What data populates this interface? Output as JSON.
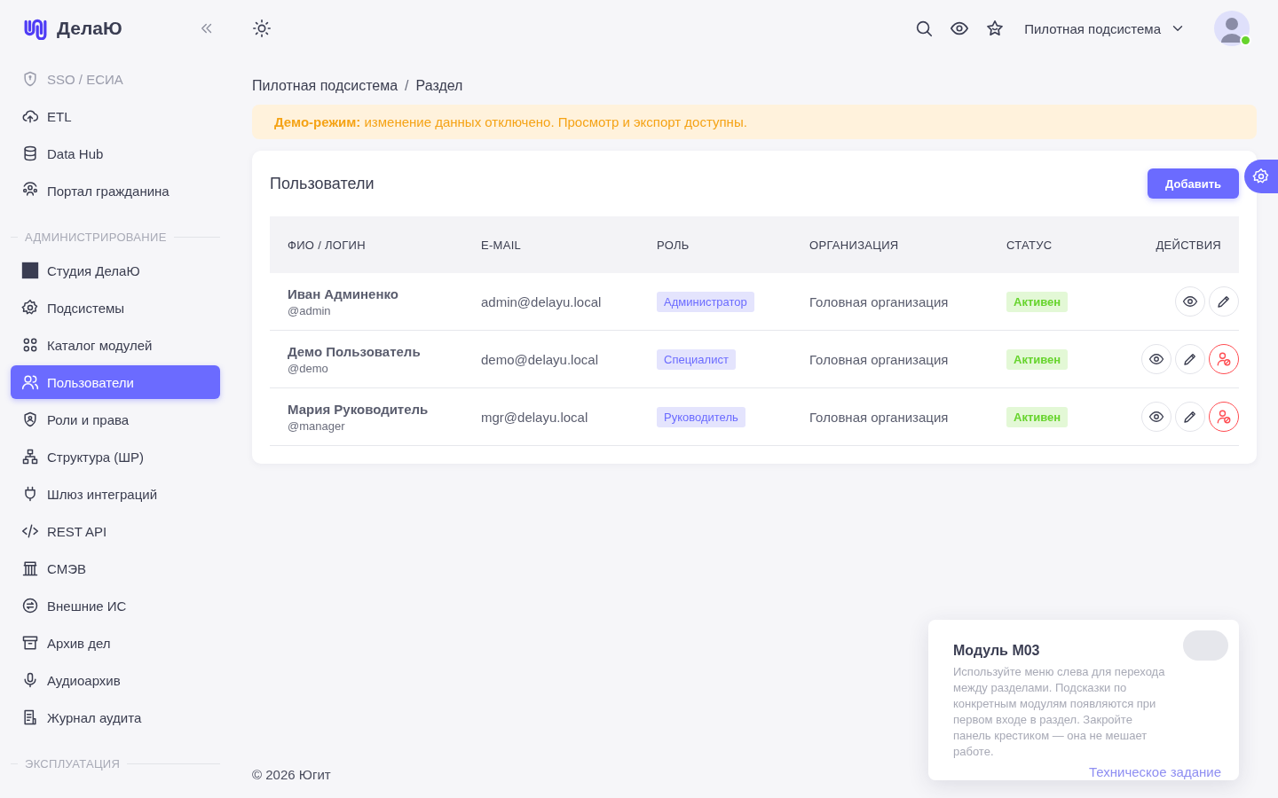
{
  "brand": {
    "name": "ДелаЮ"
  },
  "sidebar": {
    "groups": [
      {
        "items": [
          {
            "label": "SSO / ЕСИА",
            "selected": false,
            "disabled": true
          },
          {
            "label": "ETL",
            "selected": false,
            "disabled": false
          },
          {
            "label": "Data Hub",
            "selected": false,
            "disabled": false
          },
          {
            "label": "Портал гражданина",
            "selected": false,
            "disabled": false
          }
        ]
      },
      {
        "title": "АДМИНИСТРИРОВАНИЕ",
        "items": [
          {
            "label": "Студия ДелаЮ",
            "selected": false,
            "disabled": false
          },
          {
            "label": "Подсистемы",
            "selected": false,
            "disabled": false
          },
          {
            "label": "Каталог модулей",
            "selected": false,
            "disabled": false
          },
          {
            "label": "Пользователи",
            "selected": true,
            "disabled": false
          },
          {
            "label": "Роли и права",
            "selected": false,
            "disabled": false
          },
          {
            "label": "Структура (ШР)",
            "selected": false,
            "disabled": false
          },
          {
            "label": "Шлюз интеграций",
            "selected": false,
            "disabled": false
          },
          {
            "label": "REST API",
            "selected": false,
            "disabled": false
          },
          {
            "label": "СМЭВ",
            "selected": false,
            "disabled": false
          },
          {
            "label": "Внешние ИС",
            "selected": false,
            "disabled": false
          },
          {
            "label": "Архив дел",
            "selected": false,
            "disabled": false
          },
          {
            "label": "Аудиоархив",
            "selected": false,
            "disabled": false
          },
          {
            "label": "Журнал аудита",
            "selected": false,
            "disabled": false
          }
        ]
      },
      {
        "title": "ЭКСПЛУАТАЦИЯ"
      }
    ]
  },
  "header": {
    "subsystem": "Пилотная подсистема",
    "avatar": {
      "online": true
    }
  },
  "breadcrumb": {
    "items": [
      "Пилотная подсистема",
      "Раздел"
    ],
    "separator": "/"
  },
  "banner": "**Демо-режим:** изменение данных отключено. Просмотр и экспорт доступны.",
  "card": {
    "title": "Пользователи",
    "add_button": "Добавить",
    "table": {
      "columns": [
        "ФИО / ЛОГИН",
        "E-MAIL",
        "РОЛЬ",
        "ОРГАНИЗАЦИЯ",
        "СТАТУС",
        "ДЕЙСТВИЯ"
      ],
      "rows": [
        {
          "name": "Иван Админенко",
          "login": "@admin",
          "email": "admin@delayu.local",
          "role": "Администратор",
          "org": "Головная организация",
          "status": "Активен",
          "actions": [
            {
              "kind": "view"
            },
            {
              "kind": "edit"
            }
          ]
        },
        {
          "name": "Демо Пользователь",
          "login": "@demo",
          "email": "demo@delayu.local",
          "role": "Специалист",
          "org": "Головная организация",
          "status": "Активен",
          "actions": [
            {
              "kind": "view"
            },
            {
              "kind": "edit"
            },
            {
              "kind": "block"
            }
          ]
        },
        {
          "name": "Мария Руководитель",
          "login": "@manager",
          "email": "mgr@delayu.local",
          "role": "Руководитель",
          "org": "Головная организация",
          "status": "Активен",
          "actions": [
            {
              "kind": "view"
            },
            {
              "kind": "edit"
            },
            {
              "kind": "block"
            }
          ]
        }
      ]
    }
  },
  "footer": "© 2026 Югит",
  "hint": {
    "title": "Модуль М03",
    "text": "Используйте меню слева для перехода между разделами. Подсказки по конкретным модулям появляются при первом входе в раздел. Закройте панель крестиком — она не мешает работе.",
    "link": "Техническое задание"
  }
}
